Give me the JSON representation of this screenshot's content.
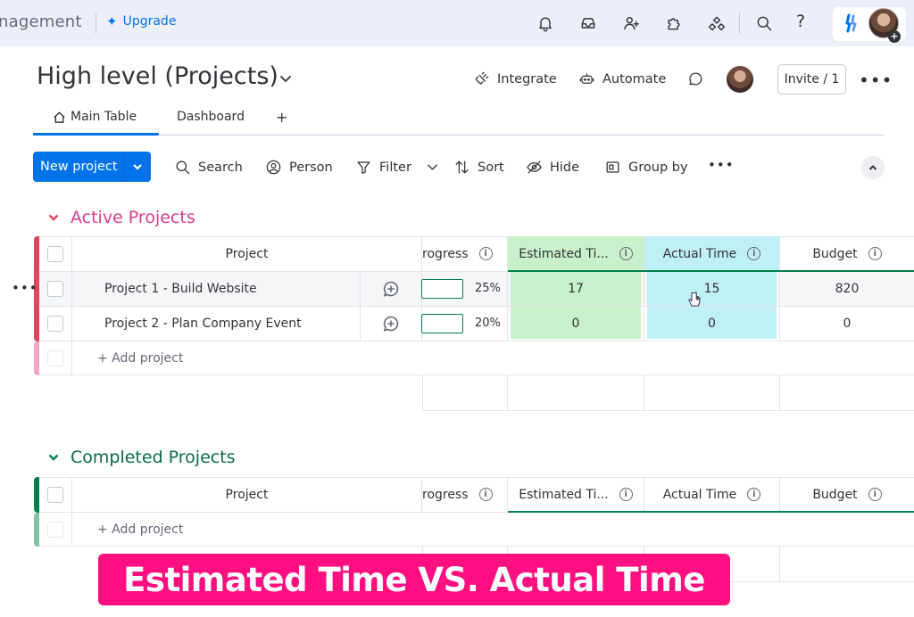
{
  "topbar": {
    "app_name": "nagement",
    "upgrade_label": "Upgrade",
    "help_label": "?"
  },
  "board": {
    "title": "High level (Projects)",
    "integrate_label": "Integrate",
    "automate_label": "Automate",
    "invite_label": "Invite / 1",
    "more_label": "•••"
  },
  "tabs": [
    {
      "label": "Main Table",
      "active": true
    },
    {
      "label": "Dashboard",
      "active": false
    }
  ],
  "tab_add_label": "+",
  "toolbar": {
    "new_label": "New project",
    "search_label": "Search",
    "person_label": "Person",
    "filter_label": "Filter",
    "sort_label": "Sort",
    "hide_label": "Hide",
    "group_by_label": "Group by",
    "more_label": "•••"
  },
  "colors": {
    "active_group": "#e2445c",
    "active_group_title": "#d63e8c",
    "completed_group": "#037f4c",
    "completed_group_title": "#0b6b4e",
    "estimated_col": "#c9f1c9",
    "actual_col": "#bfeff7",
    "accent": "#0073ea",
    "caption": "#ff0f80"
  },
  "columns": {
    "project": "Project",
    "progress": "rogress",
    "estimated": "Estimated Ti...",
    "actual": "Actual Time",
    "budget": "Budget",
    "info": "i"
  },
  "groups": {
    "active": {
      "title": "Active Projects",
      "add_label": "+ Add project",
      "rows": [
        {
          "name": "Project 1 - Build Website",
          "progress": "25%",
          "estimated": "17",
          "actual": "15",
          "budget": "820"
        },
        {
          "name": "Project 2 - Plan Company Event",
          "progress": "20%",
          "estimated": "0",
          "actual": "0",
          "budget": "0"
        }
      ]
    },
    "completed": {
      "title": "Completed Projects",
      "add_label": "+ Add project"
    }
  },
  "row_menu_label": "•••",
  "caption": "Estimated Time VS. Actual Time"
}
